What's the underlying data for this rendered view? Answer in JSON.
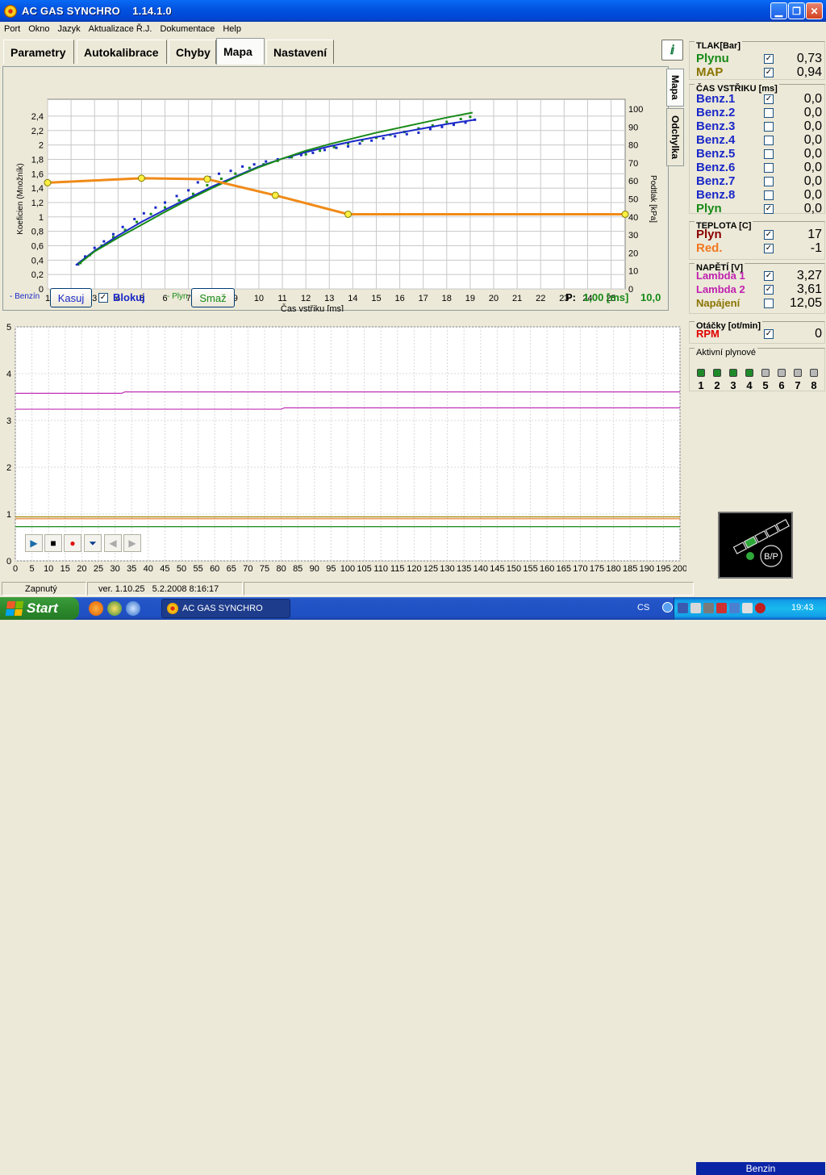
{
  "window": {
    "title": "AC GAS SYNCHRO",
    "version": "1.14.1.0"
  },
  "menu": [
    "Port",
    "Okno",
    "Jazyk",
    "Aktualizace Ř.J.",
    "Dokumentace",
    "Help"
  ],
  "tabs": [
    "Parametry",
    "Autokalibrace",
    "Chyby",
    "Mapa",
    "Nastavení"
  ],
  "active_tab": "Mapa",
  "side_tabs": [
    "Mapa",
    "Odchylka"
  ],
  "chart_data": [
    {
      "type": "scatter",
      "xlabel": "Čas vstřiku [ms]",
      "ylabel": "Koeficien (Množník)",
      "ylabel_right": "Podtlak [kPa]",
      "xlim": [
        1,
        25.6
      ],
      "ylim": [
        0,
        2.5
      ],
      "ylim_right": [
        0,
        100
      ],
      "x_ticks": [
        1,
        2,
        3,
        4,
        5,
        6,
        7,
        8,
        9,
        10,
        11,
        12,
        13,
        14,
        15,
        16,
        17,
        18,
        19,
        20,
        21,
        22,
        23,
        24,
        25
      ],
      "y_ticks": [
        "0",
        "0,2",
        "0,4",
        "0,6",
        "0,8",
        "1",
        "1,2",
        "1,4",
        "1,6",
        "1,8",
        "2",
        "2,2",
        "2,4"
      ],
      "y_right_ticks": [
        0,
        10,
        20,
        30,
        40,
        50,
        60,
        70,
        80,
        90,
        100
      ],
      "grid": true,
      "series": [
        {
          "name": "Benzín",
          "kind": "points",
          "color": "#1a28c8",
          "x": [
            2.3,
            2.6,
            3.0,
            3.4,
            3.8,
            4.2,
            4.7,
            5.1,
            5.6,
            6.0,
            6.5,
            7.0,
            7.4,
            7.9,
            8.3,
            8.8,
            9.3,
            9.8,
            10.3,
            10.8,
            11.3,
            11.8,
            12.3,
            12.8,
            13.3,
            13.8,
            14.3,
            14.8,
            15.3,
            15.8,
            16.3,
            16.8,
            17.3,
            17.8,
            18.3,
            18.8,
            19.2
          ],
          "y": [
            0.34,
            0.45,
            0.57,
            0.66,
            0.76,
            0.86,
            0.97,
            1.05,
            1.13,
            1.2,
            1.29,
            1.37,
            1.48,
            1.55,
            1.6,
            1.64,
            1.7,
            1.73,
            1.77,
            1.8,
            1.83,
            1.86,
            1.89,
            1.93,
            1.96,
            1.98,
            2.02,
            2.06,
            2.09,
            2.12,
            2.15,
            2.17,
            2.22,
            2.25,
            2.28,
            2.31,
            2.35
          ]
        },
        {
          "name": "Plyn",
          "kind": "points",
          "color": "#178a17",
          "x": [
            2.4,
            2.8,
            3.3,
            3.8,
            4.3,
            4.8,
            5.4,
            6.0,
            6.6,
            7.2,
            7.8,
            8.4,
            9.0,
            9.6,
            10.2,
            10.8,
            11.4,
            12.0,
            12.6,
            13.2,
            13.8,
            14.4,
            15.0,
            15.6,
            16.2,
            16.8,
            17.4,
            18.0,
            18.6,
            19.0
          ],
          "y": [
            0.36,
            0.47,
            0.6,
            0.72,
            0.82,
            0.93,
            1.04,
            1.13,
            1.23,
            1.32,
            1.44,
            1.53,
            1.6,
            1.68,
            1.73,
            1.78,
            1.83,
            1.87,
            1.92,
            1.97,
            2.02,
            2.06,
            2.1,
            2.14,
            2.18,
            2.23,
            2.27,
            2.32,
            2.36,
            2.39
          ]
        },
        {
          "name": "Benzín fit",
          "kind": "line",
          "color": "#1a28c8",
          "x": [
            2.2,
            3,
            4,
            5,
            6,
            7,
            8,
            9,
            10,
            11,
            12,
            13,
            14,
            15,
            16,
            17,
            18,
            19.2
          ],
          "y": [
            0.33,
            0.53,
            0.74,
            0.93,
            1.1,
            1.26,
            1.42,
            1.56,
            1.7,
            1.81,
            1.9,
            1.98,
            2.05,
            2.11,
            2.17,
            2.23,
            2.29,
            2.35
          ]
        },
        {
          "name": "Plyn fit",
          "kind": "line",
          "color": "#178a17",
          "x": [
            2.3,
            3,
            4,
            5,
            6,
            7,
            8,
            9,
            10,
            11,
            12,
            13,
            14,
            15,
            16,
            17,
            18,
            19.1
          ],
          "y": [
            0.34,
            0.52,
            0.71,
            0.89,
            1.07,
            1.24,
            1.4,
            1.55,
            1.69,
            1.81,
            1.92,
            2.01,
            2.09,
            2.17,
            2.24,
            2.31,
            2.38,
            2.45
          ]
        },
        {
          "name": "Podtlak",
          "kind": "line",
          "color": "#f08a18",
          "axis": "right",
          "x": [
            1,
            5,
            7.8,
            10.7,
            13.8,
            25.6
          ],
          "y": [
            59,
            61.5,
            61,
            52,
            41.5,
            41.5
          ],
          "markers": [
            1,
            5,
            7.8,
            10.7,
            13.8,
            25.6
          ]
        }
      ]
    },
    {
      "type": "line",
      "xlim": [
        0,
        200
      ],
      "ylim": [
        0,
        5
      ],
      "x_ticks": [
        0,
        5,
        10,
        15,
        20,
        25,
        30,
        35,
        40,
        45,
        50,
        55,
        60,
        65,
        70,
        75,
        80,
        85,
        90,
        95,
        100,
        105,
        110,
        115,
        120,
        125,
        130,
        135,
        140,
        145,
        150,
        155,
        160,
        165,
        170,
        175,
        180,
        185,
        190,
        195,
        200
      ],
      "y_ticks": [
        0,
        1,
        2,
        3,
        4,
        5
      ],
      "grid": true,
      "series": [
        {
          "name": "Lambda 2",
          "color": "#c030b8",
          "y_start": 3.58,
          "y_end": 3.61,
          "step_at": 32
        },
        {
          "name": "Lambda 1",
          "color": "#c030b8",
          "y_start": 3.24,
          "y_end": 3.27,
          "step_at": 80
        },
        {
          "name": "MAP",
          "color": "#a08000",
          "y": 0.94
        },
        {
          "name": "Plyn TLAK",
          "color": "#178a17",
          "y": 0.73
        },
        {
          "name": "Red.",
          "color": "#e07820",
          "y": 0.9
        }
      ]
    }
  ],
  "chart_controls": {
    "benzin_label": "- Benzín",
    "kasuj_label": "Kasuj",
    "blokuj_checked": "✓",
    "blokuj_label": "Blokuj",
    "plyn_label": "- Plyn",
    "smaz_label": "Smaž",
    "p_label": "P:",
    "p_value": "1,00 [ms]",
    "p_value2": "10,0"
  },
  "right_panel": {
    "tlak": {
      "title": "TLAK[Bar]",
      "rows": [
        {
          "label": "Plynu",
          "checked": true,
          "value": "0,73",
          "color": "#178a17"
        },
        {
          "label": "MAP",
          "checked": true,
          "value": "0,94",
          "color": "#8a7400"
        }
      ]
    },
    "cas": {
      "title": "ČAS VSTŘIKU  [ms]",
      "rows": [
        {
          "label": "Benz.1",
          "checked": true,
          "value": "0,0",
          "color": "#1a28c8"
        },
        {
          "label": "Benz.2",
          "checked": false,
          "value": "0,0",
          "color": "#1a28c8"
        },
        {
          "label": "Benz.3",
          "checked": false,
          "value": "0,0",
          "color": "#1a28c8"
        },
        {
          "label": "Benz.4",
          "checked": false,
          "value": "0,0",
          "color": "#1a28c8"
        },
        {
          "label": "Benz.5",
          "checked": false,
          "value": "0,0",
          "color": "#1a28c8"
        },
        {
          "label": "Benz.6",
          "checked": false,
          "value": "0,0",
          "color": "#1a28c8"
        },
        {
          "label": "Benz.7",
          "checked": false,
          "value": "0,0",
          "color": "#1a28c8"
        },
        {
          "label": "Benz.8",
          "checked": false,
          "value": "0,0",
          "color": "#1a28c8"
        },
        {
          "label": "Plyn",
          "checked": true,
          "value": "0,0",
          "color": "#178a17"
        }
      ]
    },
    "teplota": {
      "title": "TEPLOTA  [C]",
      "rows": [
        {
          "label": "Plyn",
          "checked": true,
          "value": "17",
          "color": "#8a0000"
        },
        {
          "label": "Red.",
          "checked": true,
          "value": "-1",
          "color": "#f07820"
        }
      ]
    },
    "napeti": {
      "title": "NAPĚTÍ [V]",
      "rows": [
        {
          "label": "Lambda 1",
          "checked": true,
          "value": "3,27",
          "color": "#c020b0"
        },
        {
          "label": "Lambda 2",
          "checked": true,
          "value": "3,61",
          "color": "#c020b0"
        },
        {
          "label": "Napájení",
          "checked": false,
          "value": "12,05",
          "color": "#8a7400"
        }
      ]
    },
    "otacky": {
      "title": "Otáčky [ot/min]",
      "rows": [
        {
          "label": "RPM",
          "checked": true,
          "value": "0",
          "color": "#e00000"
        }
      ]
    },
    "aktivni": {
      "title": "Aktivní plynové",
      "injectors": [
        "1",
        "2",
        "3",
        "4",
        "5",
        "6",
        "7",
        "8"
      ],
      "active_count": 4
    }
  },
  "switch_label": "B/P",
  "status": {
    "state": "Zapnutý",
    "version": "ver. 1.10.25",
    "date": "5.2.2008 8:16:17",
    "fuel": "Benzin"
  },
  "taskbar": {
    "start": "Start",
    "app": "AC GAS SYNCHRO",
    "lang": "CS",
    "clock": "19:43"
  },
  "colors": {
    "titlebar": "#0054e3",
    "accent_blue": "#1a28c8",
    "accent_green": "#178a17",
    "orange": "#f08a18",
    "magenta": "#c030b8"
  }
}
